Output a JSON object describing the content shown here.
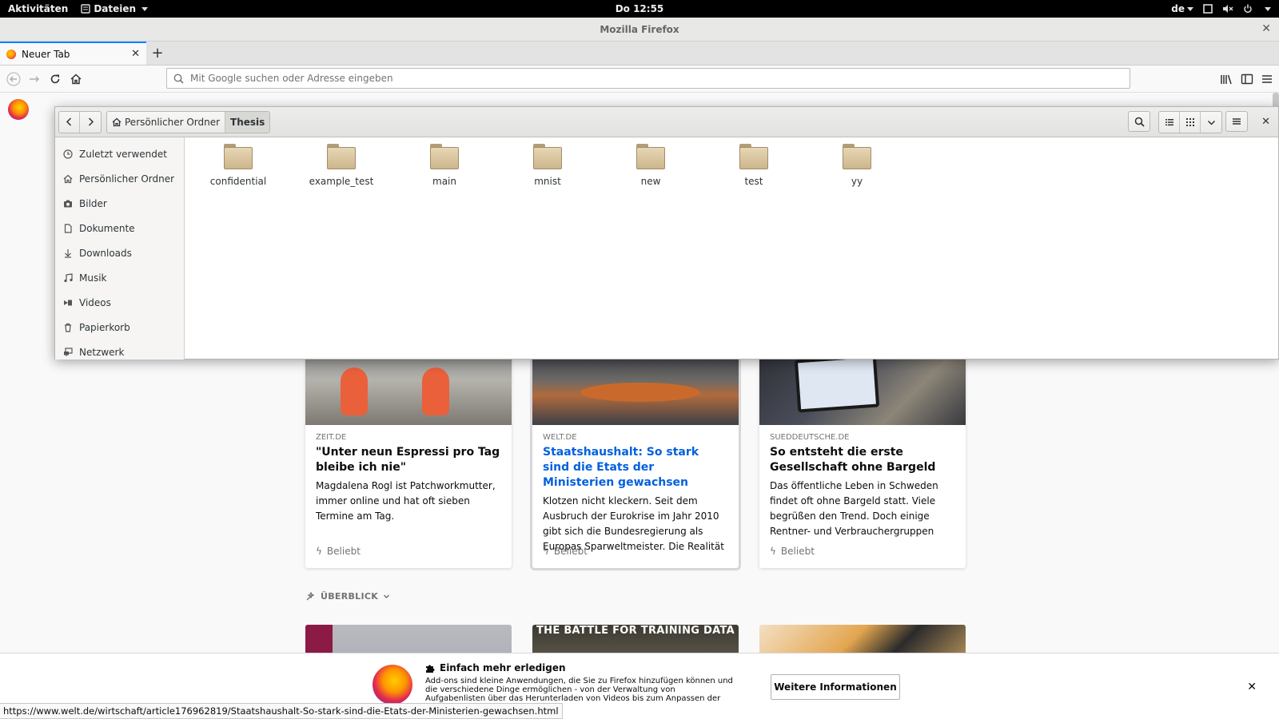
{
  "topbar": {
    "activities": "Aktivitäten",
    "app_menu": "Dateien",
    "clock": "Do 12:55",
    "keyboard_layout": "de"
  },
  "window": {
    "title": "Mozilla Firefox"
  },
  "browser": {
    "tab_title": "Neuer Tab",
    "url_placeholder": "Mit Google suchen oder Adresse eingeben"
  },
  "nautilus": {
    "breadcrumb_home": "Persönlicher Ordner",
    "breadcrumb_current": "Thesis",
    "sidebar": [
      {
        "label": "Zuletzt verwendet",
        "icon": "clock-icon"
      },
      {
        "label": "Persönlicher Ordner",
        "icon": "home-icon"
      },
      {
        "label": "Bilder",
        "icon": "camera-icon"
      },
      {
        "label": "Dokumente",
        "icon": "document-icon"
      },
      {
        "label": "Downloads",
        "icon": "download-icon"
      },
      {
        "label": "Musik",
        "icon": "music-icon"
      },
      {
        "label": "Videos",
        "icon": "video-icon"
      },
      {
        "label": "Papierkorb",
        "icon": "trash-icon"
      },
      {
        "label": "Netzwerk",
        "icon": "network-icon"
      }
    ],
    "files": [
      "confidential",
      "example_test",
      "main",
      "mnist",
      "new",
      "test",
      "yy"
    ]
  },
  "stories": [
    {
      "source": "ZEIT.DE",
      "headline": "\"Unter neun Espressi pro Tag bleibe ich nie\"",
      "excerpt": "Magdalena Rogl ist Patchworkmutter, immer online und hat oft sieben Termine am Tag.",
      "context": "Beliebt"
    },
    {
      "source": "WELT.DE",
      "headline": "Staatshaushalt: So stark sind die Etats der Ministerien gewachsen",
      "excerpt": "Klotzen nicht kleckern. Seit dem Ausbruch der Eurokrise im Jahr 2010 gibt sich die Bundesregierung als Europas Sparweltmeister. Die Realität",
      "context": "Beliebt"
    },
    {
      "source": "SUEDDEUTSCHE.DE",
      "headline": "So entsteht die erste Gesellschaft ohne Bargeld",
      "excerpt": "Das öffentliche Leben in Schweden findet oft ohne Bargeld statt. Viele begrüßen den Trend. Doch einige Rentner- und Verbrauchergruppen",
      "context": "Beliebt"
    }
  ],
  "highlights": {
    "title": "ÜBERBLICK",
    "card2_text": "THE BATTLE FOR TRAINING DATA"
  },
  "notification": {
    "title": "Einfach mehr erledigen",
    "text": "Add-ons sind kleine Anwendungen, die Sie zu Firefox hinzufügen können und die verschiedene Dinge ermöglichen - von der Verwaltung von Aufgabenlisten über das Herunterladen von Videos bis zum Anpassen der Browseroberfläche.",
    "button": "Weitere Informationen"
  },
  "status_url": "https://www.welt.de/wirtschaft/article176962819/Staatshaushalt-So-stark-sind-die-Etats-der-Ministerien-gewachsen.html"
}
